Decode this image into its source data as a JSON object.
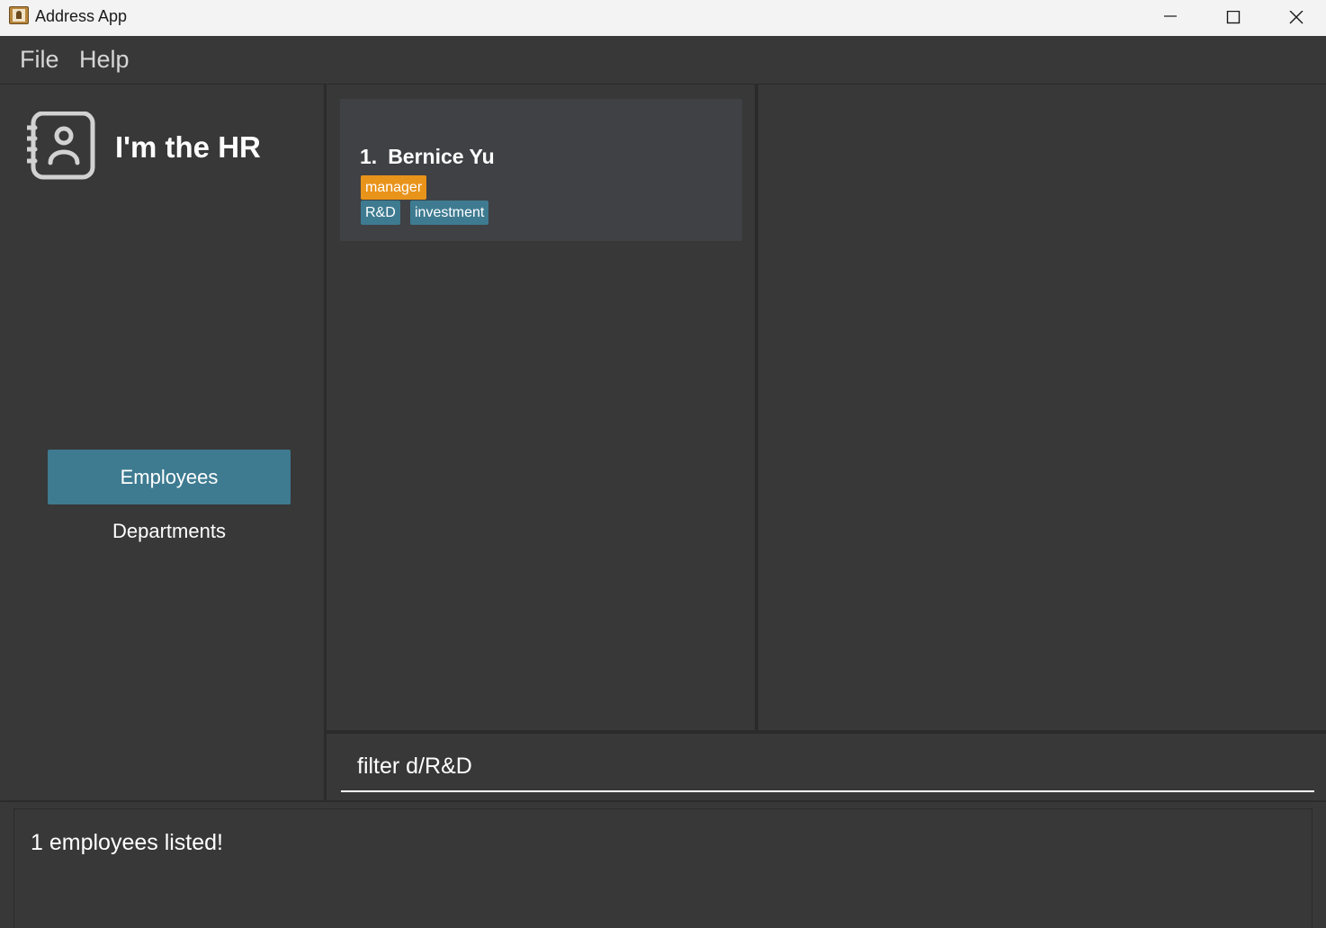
{
  "window": {
    "title": "Address App",
    "icon": "address-book-icon"
  },
  "menu": {
    "items": [
      {
        "label": "File"
      },
      {
        "label": "Help"
      }
    ]
  },
  "sidebar": {
    "logo_icon": "contact-book-icon",
    "title": "I'm the HR",
    "nav": [
      {
        "label": "Employees",
        "active": true
      },
      {
        "label": "Departments",
        "active": false
      }
    ]
  },
  "employees": [
    {
      "index": "1.",
      "name": "Bernice Yu",
      "role": "manager",
      "departments": [
        "R&D",
        "investment"
      ]
    }
  ],
  "command": {
    "value": "filter d/R&D"
  },
  "result": {
    "message": "1 employees listed!"
  },
  "colors": {
    "background": "#383838",
    "accent": "#3e7b91",
    "role_tag": "#e8931a",
    "card": "#3f4145"
  }
}
